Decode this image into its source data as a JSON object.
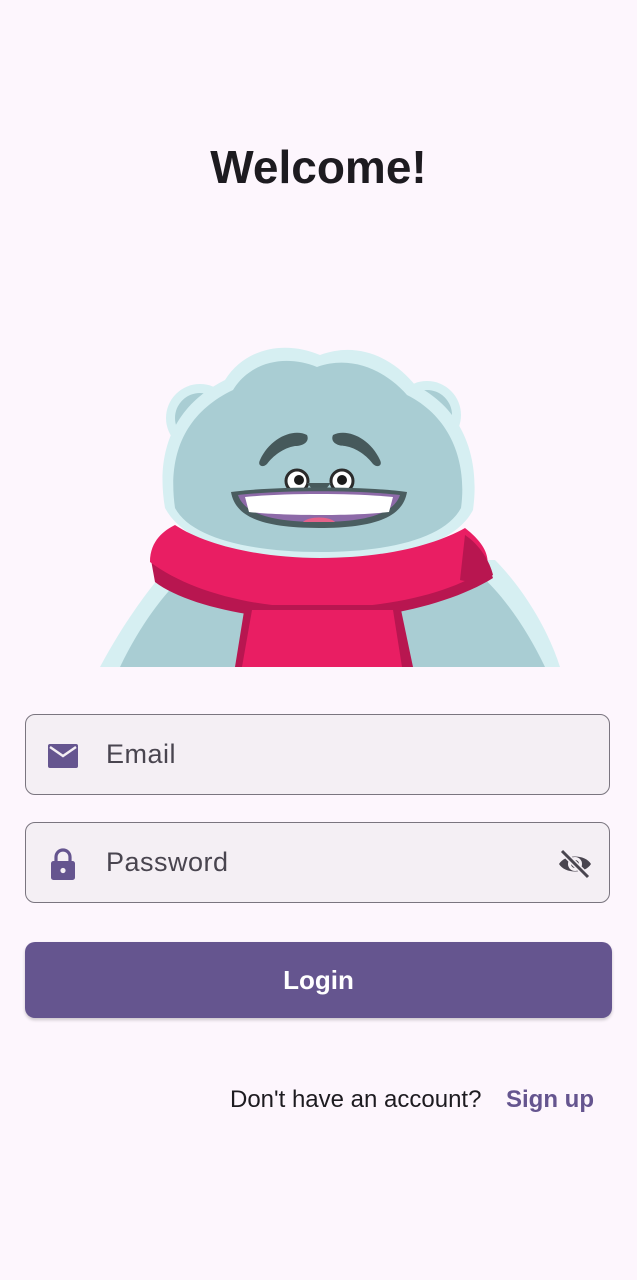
{
  "header": {
    "title": "Welcome!"
  },
  "form": {
    "email": {
      "placeholder": "Email",
      "icon": "mail-icon"
    },
    "password": {
      "placeholder": "Password",
      "icon": "lock-icon",
      "trailing_icon": "visibility-off-icon"
    },
    "login_label": "Login"
  },
  "footer": {
    "prompt": "Don't have an account?",
    "signup_label": "Sign up"
  },
  "colors": {
    "accent": "#65558f",
    "background": "#fdf6fd",
    "field_bg": "#f4eff4",
    "scarf": "#e91e63",
    "fur": "#a9cdd3"
  }
}
